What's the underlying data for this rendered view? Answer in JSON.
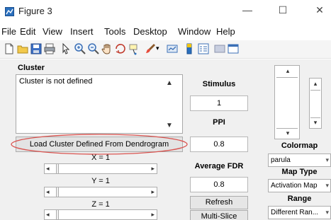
{
  "window": {
    "title": "Figure 3",
    "minimize": "—",
    "maximize": "☐",
    "close": "✕"
  },
  "menubar": {
    "items": [
      "File",
      "Edit",
      "View",
      "Insert",
      "Tools",
      "Desktop",
      "Window",
      "Help"
    ]
  },
  "toolbar": {
    "icons": [
      "new-figure-icon",
      "open-file-icon",
      "save-icon",
      "print-icon",
      "edit-plot-pointer-icon",
      "zoom-in-icon",
      "zoom-out-icon",
      "pan-hand-icon",
      "rotate-3d-icon",
      "data-cursor-icon",
      "brush-icon",
      "brush-dropdown-icon",
      "link-plot-icon",
      "insert-colorbar-icon",
      "insert-legend-icon",
      "hide-plot-tools-icon",
      "show-plot-tools-icon"
    ]
  },
  "cluster": {
    "title": "Cluster",
    "status_text": "Cluster is not defined",
    "load_button": "Load Cluster Defined From Dendrogram"
  },
  "sliders": {
    "x_label": "X = 1",
    "y_label": "Y = 1",
    "z_label": "Z = 1"
  },
  "middle": {
    "stimulus_label": "Stimulus",
    "stimulus_value": "1",
    "ppi_label": "PPI",
    "ppi_value": "0.8",
    "fdr_label": "Average FDR",
    "fdr_value": "0.8",
    "refresh_button": "Refresh",
    "multislice_button": "Multi-Slice"
  },
  "right": {
    "colormap_label": "Colormap",
    "colormap_value": "parula",
    "maptype_label": "Map Type",
    "maptype_value": "Activation Map",
    "range_label": "Range",
    "range_value": "Different Ran..."
  },
  "colors": {
    "panel_bg": "#f0f0f0",
    "highlight_ellipse": "#d9534f",
    "app_icon_blue": "#2a6fbd"
  }
}
